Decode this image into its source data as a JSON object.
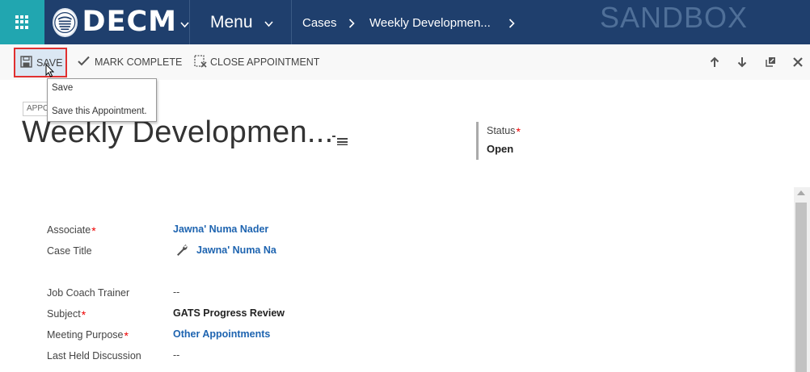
{
  "topnav": {
    "brand": "DECM",
    "menu_label": "Menu",
    "breadcrumbs": [
      "Cases",
      "Weekly Developmen..."
    ],
    "environment": "SANDBOX"
  },
  "commandbar": {
    "save_label": "SAVE",
    "mark_complete_label": "MARK COMPLETE",
    "close_appointment_label": "CLOSE APPOINTMENT"
  },
  "tooltip": {
    "title": "Save",
    "description": "Save this Appointment."
  },
  "header": {
    "entity_label": "APPO",
    "record_title": "Weekly Developmen...",
    "status_label": "Status",
    "status_value": "Open"
  },
  "fields": [
    {
      "label": "Associate",
      "required": true,
      "value": "Jawna' Numa Nader",
      "style": "link"
    },
    {
      "label": "Case Title",
      "required": false,
      "value": "Jawna' Numa Na",
      "style": "link"
    },
    {
      "label": "Job Coach Trainer",
      "required": false,
      "value": "--",
      "style": "plain"
    },
    {
      "label": "Subject",
      "required": true,
      "value": "GATS Progress Review",
      "style": "bold"
    },
    {
      "label": "Meeting Purpose",
      "required": true,
      "value": "Other Appointments",
      "style": "link"
    },
    {
      "label": "Last Held Discussion",
      "required": false,
      "value": "--",
      "style": "plain"
    }
  ],
  "colors": {
    "nav_bg": "#1f3f6d",
    "app_launcher_bg": "#21a6b0",
    "link": "#1e64b0",
    "required": "#ee0000",
    "highlight_border": "#e03030"
  }
}
